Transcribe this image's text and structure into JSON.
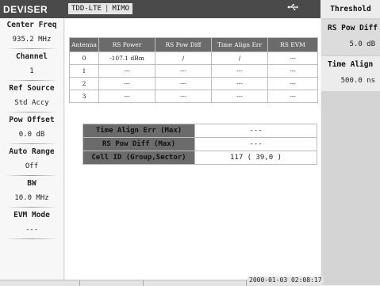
{
  "header": {
    "logo": "DEVISER",
    "mode": "TDD-LTE",
    "submode": "MIMO",
    "usb_icon": "usb-icon"
  },
  "left_panel": [
    {
      "label": "Center Freq",
      "value": "935.2 MHz"
    },
    {
      "label": "Channel",
      "value": "1"
    },
    {
      "label": "Ref Source",
      "value": "Std Accy"
    },
    {
      "label": "Pow Offset",
      "value": "0.0 dB"
    },
    {
      "label": "Auto Range",
      "value": "Off"
    },
    {
      "label": "BW",
      "value": "10.0 MHz"
    },
    {
      "label": "EVM Mode",
      "value": "---"
    }
  ],
  "antenna_table": {
    "headers": [
      "Antenna",
      "RS Power",
      "RS Pow Diff",
      "Time Align Err",
      "RS EVM"
    ],
    "rows": [
      [
        "0",
        "-107.1 dBm",
        "/",
        "/",
        "---"
      ],
      [
        "1",
        "---",
        "---",
        "---",
        "---"
      ],
      [
        "2",
        "---",
        "---",
        "---",
        "---"
      ],
      [
        "3",
        "---",
        "---",
        "---",
        "---"
      ]
    ]
  },
  "summary_table": [
    {
      "label": "Time Align Err (Max)",
      "value": "---"
    },
    {
      "label": "RS Pow Diff (Max)",
      "value": "---"
    },
    {
      "label": "Cell ID (Group,Sector)",
      "value": "117 ( 39,0 )"
    }
  ],
  "right_panel": {
    "title": "Threshold",
    "softkeys": [
      {
        "label": "RS Pow Diff",
        "value": "5.0 dB"
      },
      {
        "label": "Time Align",
        "value": "500.0 ns"
      }
    ]
  },
  "status": {
    "datetime": "2000-01-03 02:08:17"
  }
}
